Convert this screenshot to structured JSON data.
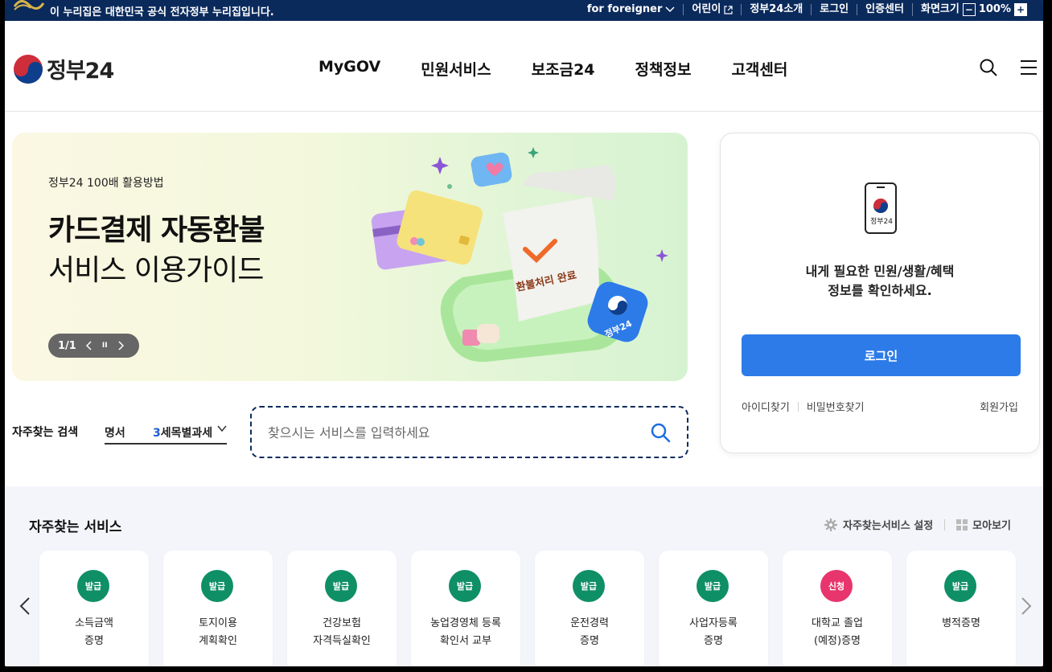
{
  "topbar": {
    "gov_notice": "이 누리집은 대한민국 공식 전자정부 누리집입니다.",
    "foreigner": "for foreigner",
    "kids": "어린이",
    "about": "정부24소개",
    "login": "로그인",
    "cert": "인증센터",
    "zoom_label": "화면크기",
    "zoom_minus": "−",
    "zoom_value": "100%",
    "zoom_plus": "+"
  },
  "header": {
    "logo_text": "정부24",
    "menu": [
      "MyGOV",
      "민원서비스",
      "보조금24",
      "정책정보",
      "고객센터"
    ]
  },
  "banner": {
    "eyebrow": "정부24 100배 활용방법",
    "title_bold": "카드결제 자동환불",
    "title_light": "서비스 이용가이드",
    "receipt_text": "환불처리 완료",
    "pager": "1/1",
    "pause": "II",
    "badge_text": "정부24"
  },
  "frequent_search": {
    "label": "자주찾는 검색",
    "prev_item": "명서",
    "current_rank": "3",
    "current_item": "세목별과세"
  },
  "search": {
    "placeholder": "찾으시는 서비스를 입력하세요"
  },
  "login_card": {
    "phone_label": "정부24",
    "message_line1": "내게 필요한 민원/생활/혜택",
    "message_line2": "정보를 확인하세요.",
    "login_button": "로그인",
    "find_id": "아이디찾기",
    "find_pw": "비밀번호찾기",
    "join": "회원가입"
  },
  "services": {
    "title": "자주찾는 서비스",
    "settings": "자주찾는서비스 설정",
    "view_all": "모아보기",
    "colors": {
      "issue": "#0f8f66",
      "apply": "#e8356d"
    },
    "cards": [
      {
        "badge": "발급",
        "type": "issue",
        "label": "소득금액\n증명"
      },
      {
        "badge": "발급",
        "type": "issue",
        "label": "토지이용\n계획확인"
      },
      {
        "badge": "발급",
        "type": "issue",
        "label": "건강보험\n자격득실확인"
      },
      {
        "badge": "발급",
        "type": "issue",
        "label": "농업경영체 등록\n확인서 교부"
      },
      {
        "badge": "발급",
        "type": "issue",
        "label": "운전경력\n증명"
      },
      {
        "badge": "발급",
        "type": "issue",
        "label": "사업자등록\n증명"
      },
      {
        "badge": "신청",
        "type": "apply",
        "label": "대학교 졸업\n(예정)증명"
      },
      {
        "badge": "발급",
        "type": "issue",
        "label": "병적증명"
      }
    ]
  }
}
